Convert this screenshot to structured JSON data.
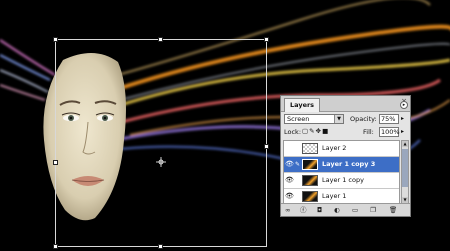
{
  "canvas": {
    "background": "#000000",
    "cursor_icon": "crosshair-icon"
  },
  "layers_panel": {
    "tab_label": "Layers",
    "close_icon": "close-icon",
    "menu_icon": "panel-menu-icon",
    "blend_mode": "Screen",
    "opacity_label": "Opacity:",
    "opacity_value": "75%",
    "lock_label": "Lock:",
    "fill_label": "Fill:",
    "fill_value": "100%",
    "layers": [
      {
        "name": "Layer 2",
        "visible": false,
        "selected": false
      },
      {
        "name": "Layer 1 copy 3",
        "visible": true,
        "selected": true
      },
      {
        "name": "Layer 1 copy",
        "visible": true,
        "selected": false
      },
      {
        "name": "Layer 1",
        "visible": true,
        "selected": false
      }
    ],
    "selection_color": "#3d6ec6",
    "bottom_icons": [
      "link-icon",
      "fx-icon",
      "mask-icon",
      "adjustment-icon",
      "folder-icon",
      "new-layer-icon",
      "trash-icon"
    ]
  }
}
